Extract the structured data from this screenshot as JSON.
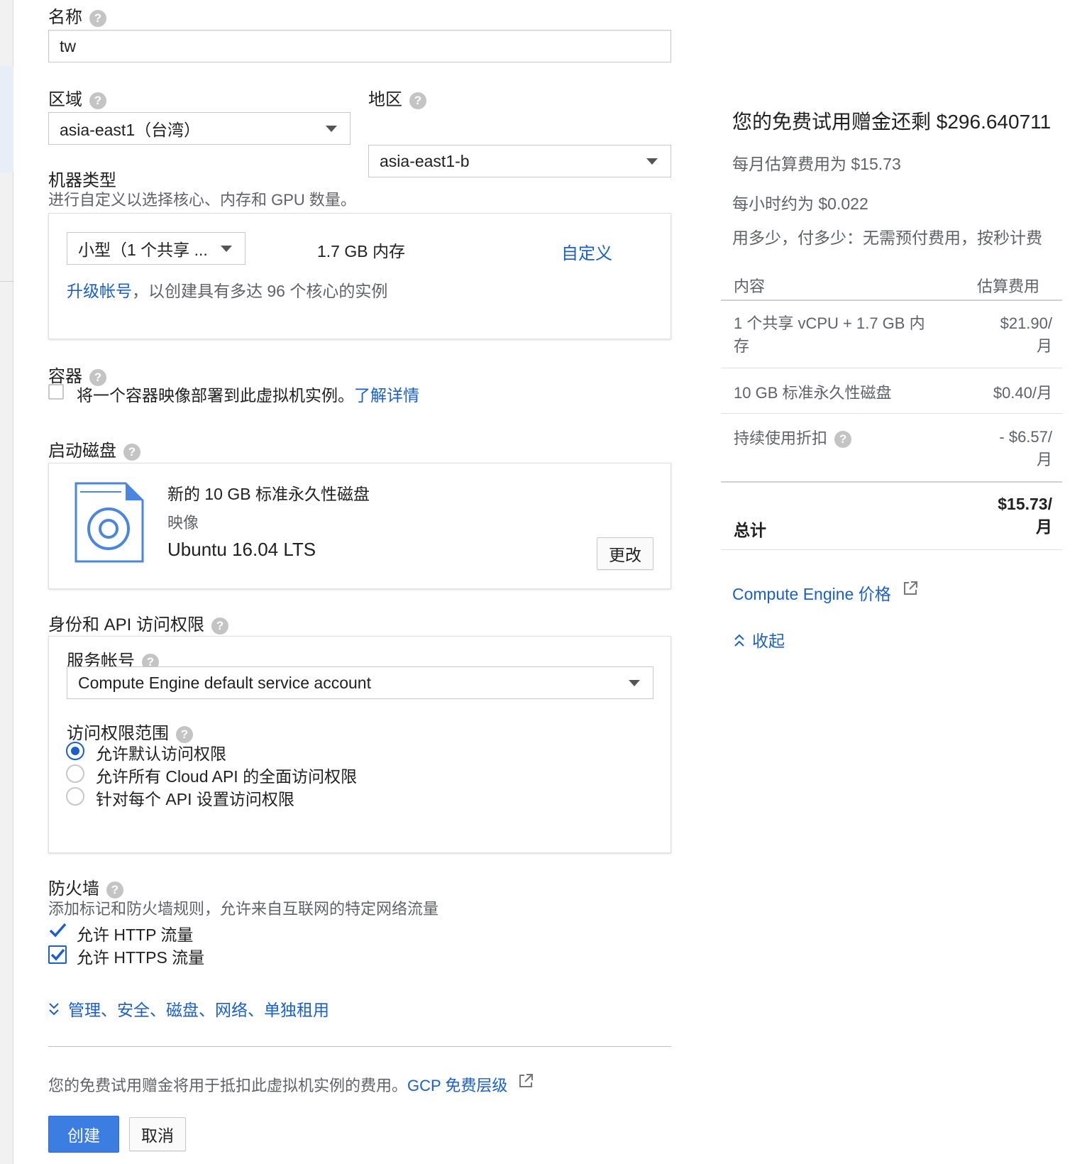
{
  "name": {
    "label": "名称",
    "value": "tw"
  },
  "region": {
    "label": "区域",
    "value": "asia-east1（台湾）"
  },
  "zone": {
    "label": "地区",
    "value": "asia-east1-b"
  },
  "machine": {
    "label": "机器类型",
    "description": "进行自定义以选择核心、内存和 GPU 数量。",
    "type_value": "小型（1 个共享 ...",
    "memory": "1.7 GB 内存",
    "customize": "自定义",
    "upgrade_link": "升级帐号",
    "upgrade_text": "，以创建具有多达 96 个核心的实例"
  },
  "container": {
    "label": "容器",
    "checkbox_text": "将一个容器映像部署到此虚拟机实例。",
    "learn_more": "了解详情",
    "checked": false
  },
  "boot_disk": {
    "label": "启动磁盘",
    "title": "新的 10 GB 标准永久性磁盘",
    "image_label": "映像",
    "image": "Ubuntu 16.04 LTS",
    "change_button": "更改"
  },
  "identity": {
    "label": "身份和 API 访问权限",
    "service_account_label": "服务帐号",
    "service_account": "Compute Engine default service account",
    "scope_label": "访问权限范围",
    "scopes": [
      {
        "label": "允许默认访问权限",
        "selected": true
      },
      {
        "label": "允许所有 Cloud API 的全面访问权限",
        "selected": false
      },
      {
        "label": "针对每个 API 设置访问权限",
        "selected": false
      }
    ]
  },
  "firewall": {
    "label": "防火墙",
    "description": "添加标记和防火墙规则，允许来自互联网的特定网络流量",
    "options": [
      {
        "label": "允许 HTTP 流量",
        "checked": true
      },
      {
        "label": "允许 HTTPS 流量",
        "checked": true
      }
    ]
  },
  "advanced_link": "管理、安全、磁盘、网络、单独租用",
  "footer": {
    "note": "您的免费试用赠金将用于抵扣此虚拟机实例的费用。",
    "tier_link": "GCP 免费层级",
    "create": "创建",
    "cancel": "取消"
  },
  "pricing": {
    "credit": "您的免费试用赠金还剩 $296.640711",
    "monthly": "每月估算费用为 $15.73",
    "hourly": "每小时约为 $0.022",
    "pay_note": "用多少，付多少：无需预付费用，按秒计费",
    "col_item": "内容",
    "col_cost": "估算费用",
    "rows": [
      {
        "item_l1": "1 个共享 vCPU + 1.7 GB 内",
        "item_l2": "存",
        "cost_l1": "$21.90/",
        "cost_l2": "月"
      },
      {
        "item_l1": "10 GB 标准永久性磁盘",
        "cost_l1": "$0.40/月"
      },
      {
        "item_l1": "持续使用折扣",
        "cost_l1": "- $6.57/",
        "cost_l2": "月"
      }
    ],
    "total_label": "总计",
    "total_l1": "$15.73/",
    "total_l2": "月",
    "pricing_link": "Compute Engine 价格",
    "collapse": "收起"
  },
  "colors": {
    "accent": "#1a5fcc",
    "primary_button": "#3b7de0"
  }
}
